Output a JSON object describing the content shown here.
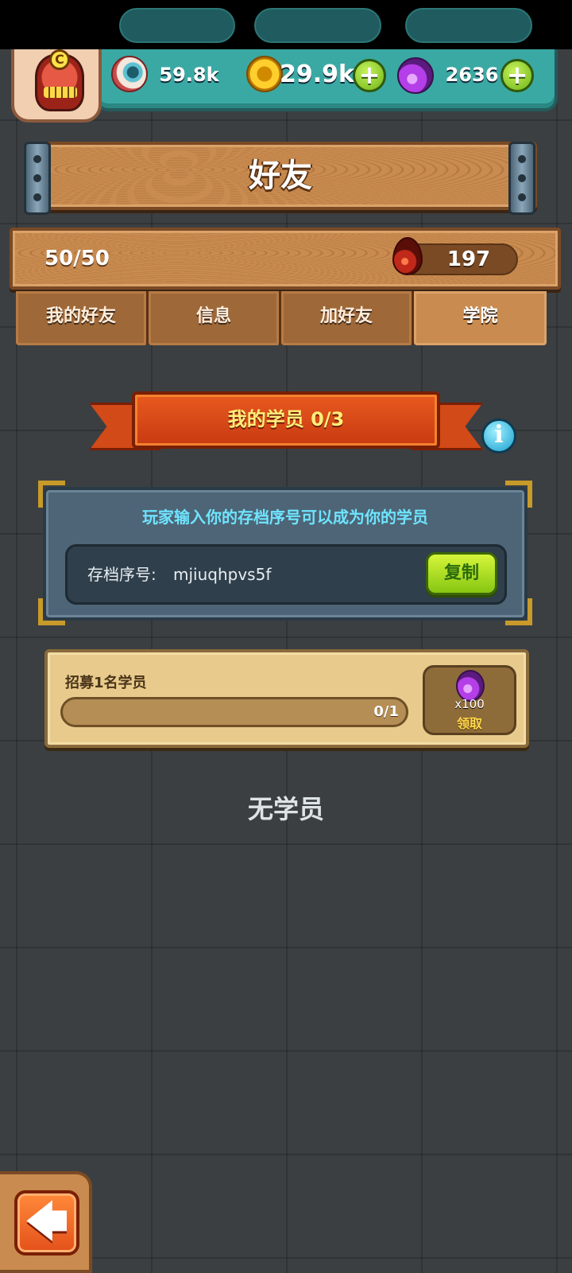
{
  "resources": {
    "eyes": "59.8k",
    "coins": "29.9k",
    "potions": "2636",
    "plus_symbol": "+"
  },
  "avatar": {
    "badge": "C"
  },
  "header": {
    "title": "好友"
  },
  "stats": {
    "friends_count": "50/50",
    "blood_value": "197"
  },
  "tabs": [
    {
      "label": "我的好友",
      "active": false
    },
    {
      "label": "信息",
      "active": false
    },
    {
      "label": "加好友",
      "active": false
    },
    {
      "label": "学院",
      "active": true
    }
  ],
  "academy": {
    "ribbon_title": "我的学员 0/3",
    "info_symbol": "i",
    "hint": "玩家输入你的存档序号可以成为你的学员",
    "code_label": "存档序号:",
    "code_value": "mjiuqhpvs5f",
    "copy_label": "复制"
  },
  "task": {
    "title": "招募1名学员",
    "progress_text": "0/1",
    "progress_fraction": 0,
    "reward_count": "x100",
    "claim_label": "领取"
  },
  "empty_message": "无学员",
  "back_symbol": "🡄",
  "colors": {
    "accent_teal": "#3aa9a3",
    "wood": "#c98b4f",
    "ribbon": "#e85a1e",
    "hint_text": "#6fe4ff",
    "copy_green": "#86c612"
  }
}
